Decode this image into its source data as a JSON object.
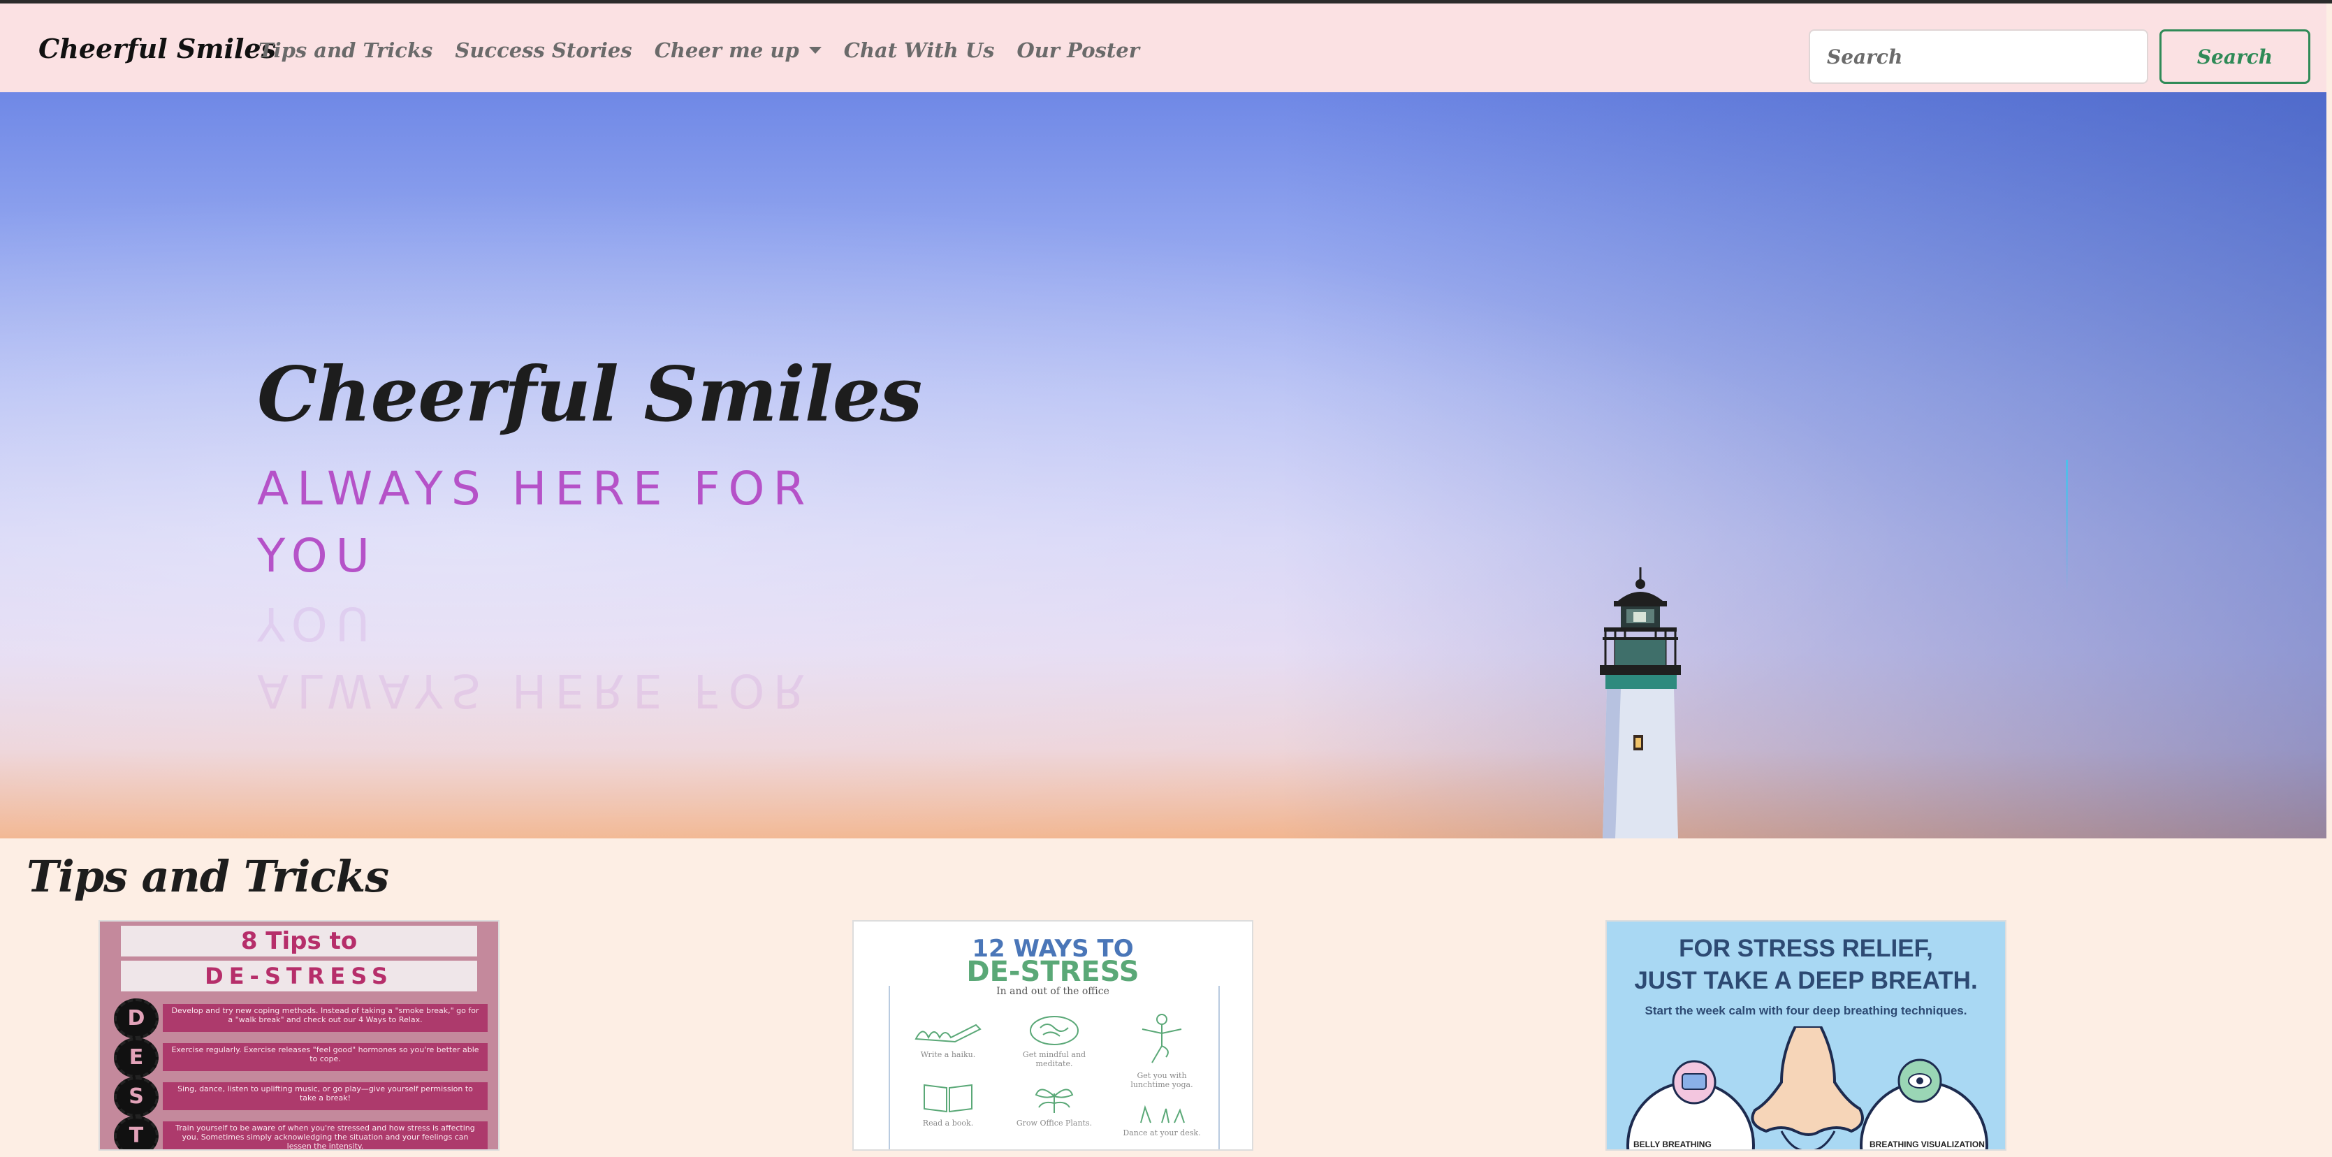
{
  "navbar": {
    "brand": "Cheerful Smiles",
    "links": [
      {
        "label": "Tips and Tricks"
      },
      {
        "label": "Success Stories"
      },
      {
        "label": "Cheer me up"
      },
      {
        "label": "Chat With Us"
      },
      {
        "label": "Our Poster"
      }
    ],
    "search_placeholder": "Search",
    "search_button": "Search"
  },
  "hero": {
    "title": "Cheerful Smiles",
    "subtitle": "ALWAYS HERE FOR YOU"
  },
  "tips": {
    "title": "Tips and Tricks",
    "cards": [
      {
        "heading_line1": "8 Tips to",
        "heading_line2": "DE-STRESS",
        "rows": [
          {
            "letter": "D",
            "text": "Develop and try new coping methods. Instead of taking a \"smoke break,\" go for a \"walk break\" and check out our 4 Ways to Relax."
          },
          {
            "letter": "E",
            "text": "Exercise regularly. Exercise releases \"feel good\" hormones so you're better able to cope."
          },
          {
            "letter": "S",
            "text": "Sing, dance, listen to uplifting music, or go play—give yourself permission to take a break!"
          },
          {
            "letter": "T",
            "text": "Train yourself to be aware of when you're stressed and how stress is affecting you. Sometimes simply acknowledging the situation and your feelings can lessen the intensity."
          }
        ]
      },
      {
        "heading_line1": "12 WAYS TO",
        "heading_line2": "DE-STRESS",
        "subheading": "In and out of the office",
        "items": [
          {
            "text": "Write a haiku."
          },
          {
            "text": "Get mindful and meditate."
          },
          {
            "text": "Get you with lunchtime yoga."
          },
          {
            "text": "Read a book."
          },
          {
            "text": "Grow Office Plants."
          },
          {
            "text": "Dance at your desk."
          }
        ]
      },
      {
        "heading_line1": "FOR STRESS RELIEF,",
        "heading_line2": "JUST TAKE A DEEP BREATH.",
        "subheading": "Start the week calm with four deep breathing techniques.",
        "label_left": "BELLY BREATHING",
        "label_right": "BREATHING VISUALIZATION"
      }
    ]
  },
  "colors": {
    "navbar_bg": "#fbe1e3",
    "accent_green": "#2f8a57",
    "subtitle_purple": "#b552c8",
    "section_bg": "#fdeee4"
  }
}
